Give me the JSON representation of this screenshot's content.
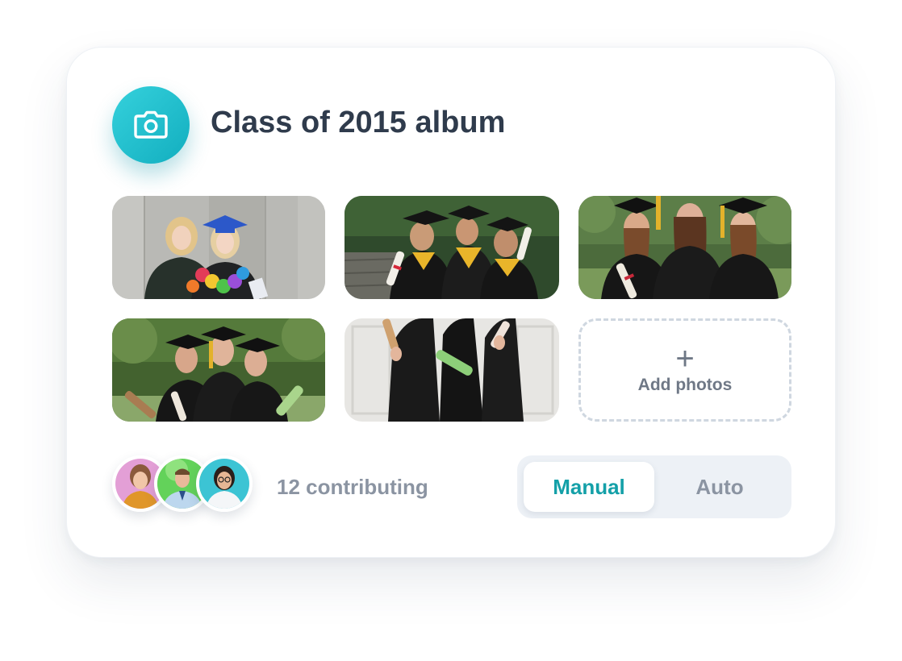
{
  "album": {
    "title": "Class of 2015 album",
    "icon": "camera-icon",
    "accent_color": "#1fbfcc"
  },
  "photos": [
    {
      "name": "photo-two-graduates-hugging"
    },
    {
      "name": "photo-three-graduates-sitting"
    },
    {
      "name": "photo-three-graduates-trees"
    },
    {
      "name": "photo-graduates-with-diplomas"
    },
    {
      "name": "photo-graduates-in-gowns"
    }
  ],
  "add_photos": {
    "icon": "plus-icon",
    "plus_glyph": "+",
    "label": "Add photos"
  },
  "contributors": {
    "count_text": "12 contributing",
    "avatars": [
      "avatar-woman-pink",
      "avatar-man-green",
      "avatar-woman-teal"
    ]
  },
  "mode_toggle": {
    "options": [
      "Manual",
      "Auto"
    ],
    "selected": "Manual",
    "selected_color": "#14a0a8"
  }
}
